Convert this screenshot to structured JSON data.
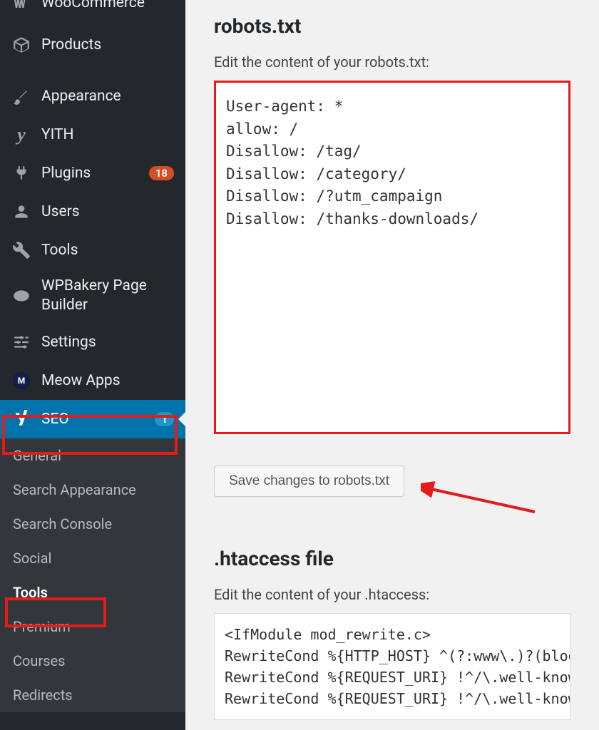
{
  "sidebar": {
    "items": [
      {
        "label": "WooCommerce"
      },
      {
        "label": "Products"
      },
      {
        "label": "Appearance"
      },
      {
        "label": "YITH"
      },
      {
        "label": "Plugins",
        "badge": "18"
      },
      {
        "label": "Users"
      },
      {
        "label": "Tools"
      },
      {
        "label": "WPBakery Page Builder"
      },
      {
        "label": "Settings"
      },
      {
        "label": "Meow Apps"
      },
      {
        "label": "SEO",
        "badge": "1"
      }
    ],
    "submenu": [
      {
        "label": "General"
      },
      {
        "label": "Search Appearance"
      },
      {
        "label": "Search Console"
      },
      {
        "label": "Social"
      },
      {
        "label": "Tools"
      },
      {
        "label": "Premium"
      },
      {
        "label": "Courses"
      },
      {
        "label": "Redirects"
      }
    ]
  },
  "main": {
    "robots_heading": "robots.txt",
    "robots_desc": "Edit the content of your robots.txt:",
    "robots_content": "User-agent: *\nallow: /\nDisallow: /tag/\nDisallow: /category/\nDisallow: /?utm_campaign\nDisallow: /thanks-downloads/",
    "save_label": "Save changes to robots.txt",
    "htaccess_heading": ".htaccess file",
    "htaccess_desc": "Edit the content of your .htaccess:",
    "htaccess_content": "<IfModule mod_rewrite.c>\nRewriteCond %{HTTP_HOST} ^(?:www\\.)?(blog)\\\nRewriteCond %{REQUEST_URI} !^/\\.well-known/\nRewriteCond %{REQUEST_URI} !^/\\.well-known/"
  }
}
